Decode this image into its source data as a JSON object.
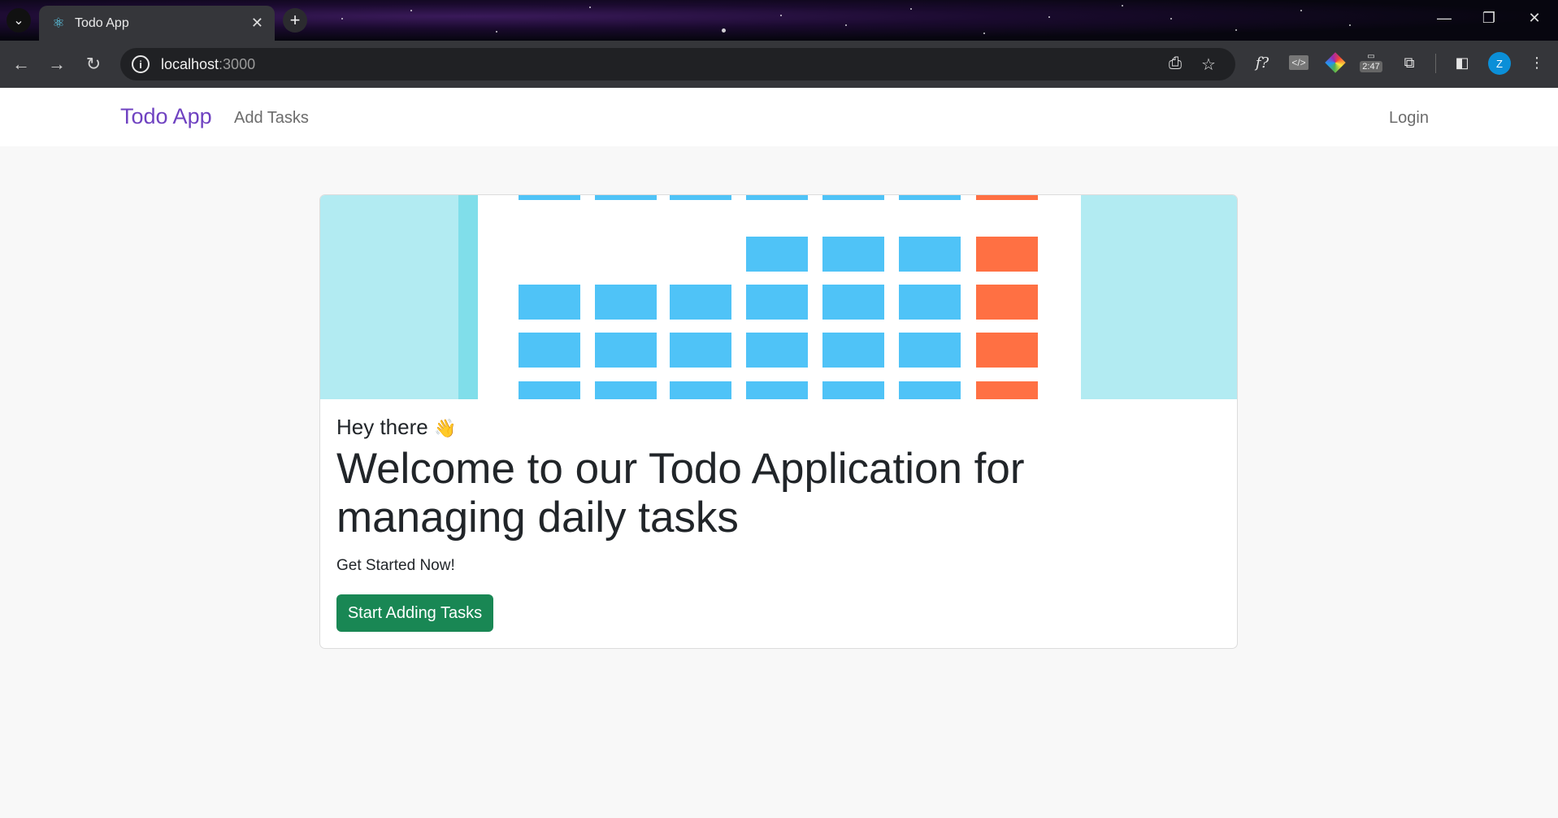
{
  "browser": {
    "tab_title": "Todo App",
    "url_host": "localhost",
    "url_port": ":3000",
    "extension_badge": "2:47",
    "profile_initial": "Z"
  },
  "navbar": {
    "brand": "Todo App",
    "add_tasks": "Add Tasks",
    "login": "Login",
    "brand_color": "#6f42c1"
  },
  "hero": {
    "background_color": "#b2ebf2",
    "block_color": "#4fc3f7",
    "accent_color": "#ff7043"
  },
  "card": {
    "greeting": "Hey there",
    "greeting_emoji": "👋",
    "headline": "Welcome to our Todo Application for managing daily tasks",
    "lead": "Get Started Now!",
    "cta_label": "Start Adding Tasks",
    "cta_color": "#198754"
  }
}
